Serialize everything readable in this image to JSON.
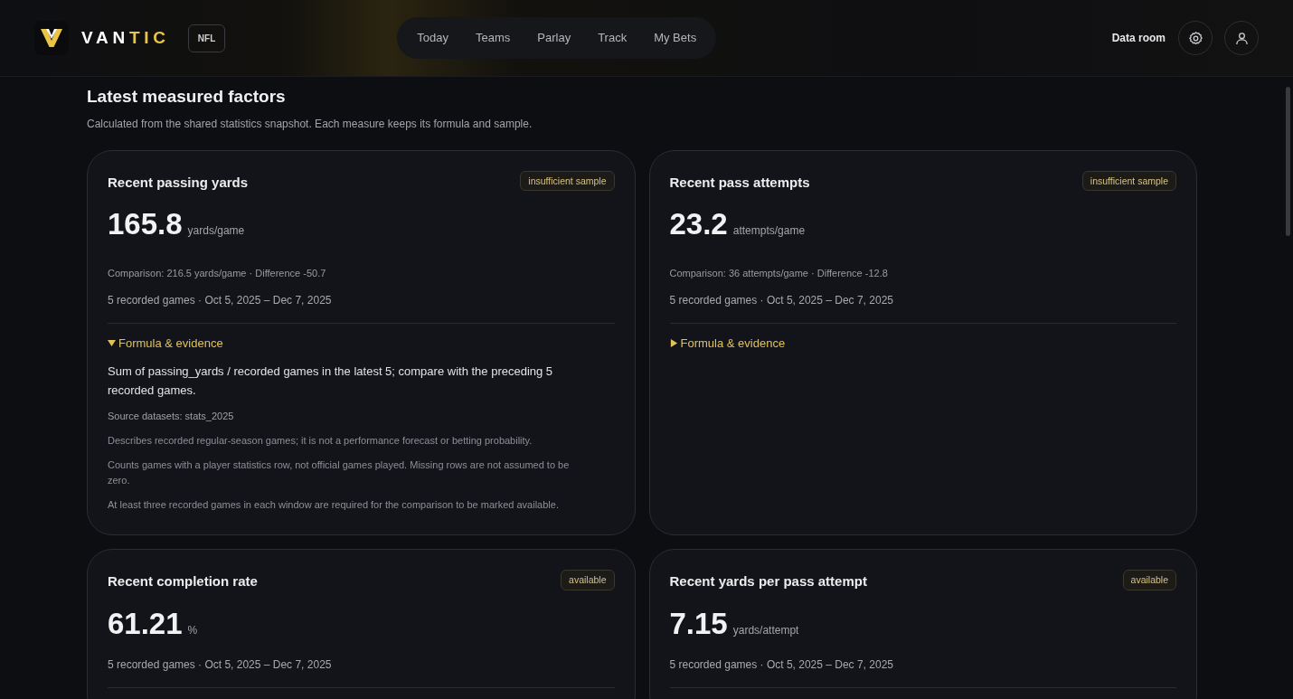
{
  "brand": {
    "wordmark": [
      {
        "text": "VAN",
        "accent": false
      },
      {
        "text": "TIC",
        "accent": true
      }
    ],
    "league": "NFL"
  },
  "nav": [
    {
      "label": "Today",
      "selected": false
    },
    {
      "label": "Teams",
      "selected": false
    },
    {
      "label": "Parlay",
      "selected": false
    },
    {
      "label": "Track",
      "selected": false
    },
    {
      "label": "My Bets",
      "selected": false
    }
  ],
  "header_link": "Data room",
  "section": {
    "title": "Latest measured factors",
    "subtitle": "Calculated from the shared statistics snapshot. Each measure keeps its formula and sample."
  },
  "cards": [
    {
      "title": "Recent passing yards",
      "badge": "insufficient sample",
      "value": "165.8",
      "unit": "yards/game",
      "comparison": "Comparison: 216.5 yards/game · Difference -50.7",
      "sample": "5 recorded games · Oct 5, 2025 – Dec 7, 2025",
      "formula": {
        "label": "Formula & evidence",
        "expanded": true,
        "definition": "Sum of passing_yards / recorded games in the latest 5; compare with the preceding 5 recorded games.",
        "notes": [
          "Source datasets: stats_2025",
          "Describes recorded regular-season games; it is not a performance forecast or betting probability.",
          "Counts games with a player statistics row, not official games played. Missing rows are not assumed to be zero.",
          "At least three recorded games in each window are required for the comparison to be marked available."
        ]
      }
    },
    {
      "title": "Recent pass attempts",
      "badge": "insufficient sample",
      "value": "23.2",
      "unit": "attempts/game",
      "comparison": "Comparison: 36 attempts/game · Difference -12.8",
      "sample": "5 recorded games · Oct 5, 2025 – Dec 7, 2025",
      "formula": {
        "label": "Formula & evidence",
        "expanded": false
      }
    },
    {
      "title": "Recent completion rate",
      "badge": "available",
      "value": "61.21",
      "unit": "%",
      "sample": "5 recorded games · Oct 5, 2025 – Dec 7, 2025"
    },
    {
      "title": "Recent yards per pass attempt",
      "badge": "available",
      "value": "7.15",
      "unit": "yards/attempt",
      "sample": "5 recorded games · Oct 5, 2025 – Dec 7, 2025"
    }
  ]
}
